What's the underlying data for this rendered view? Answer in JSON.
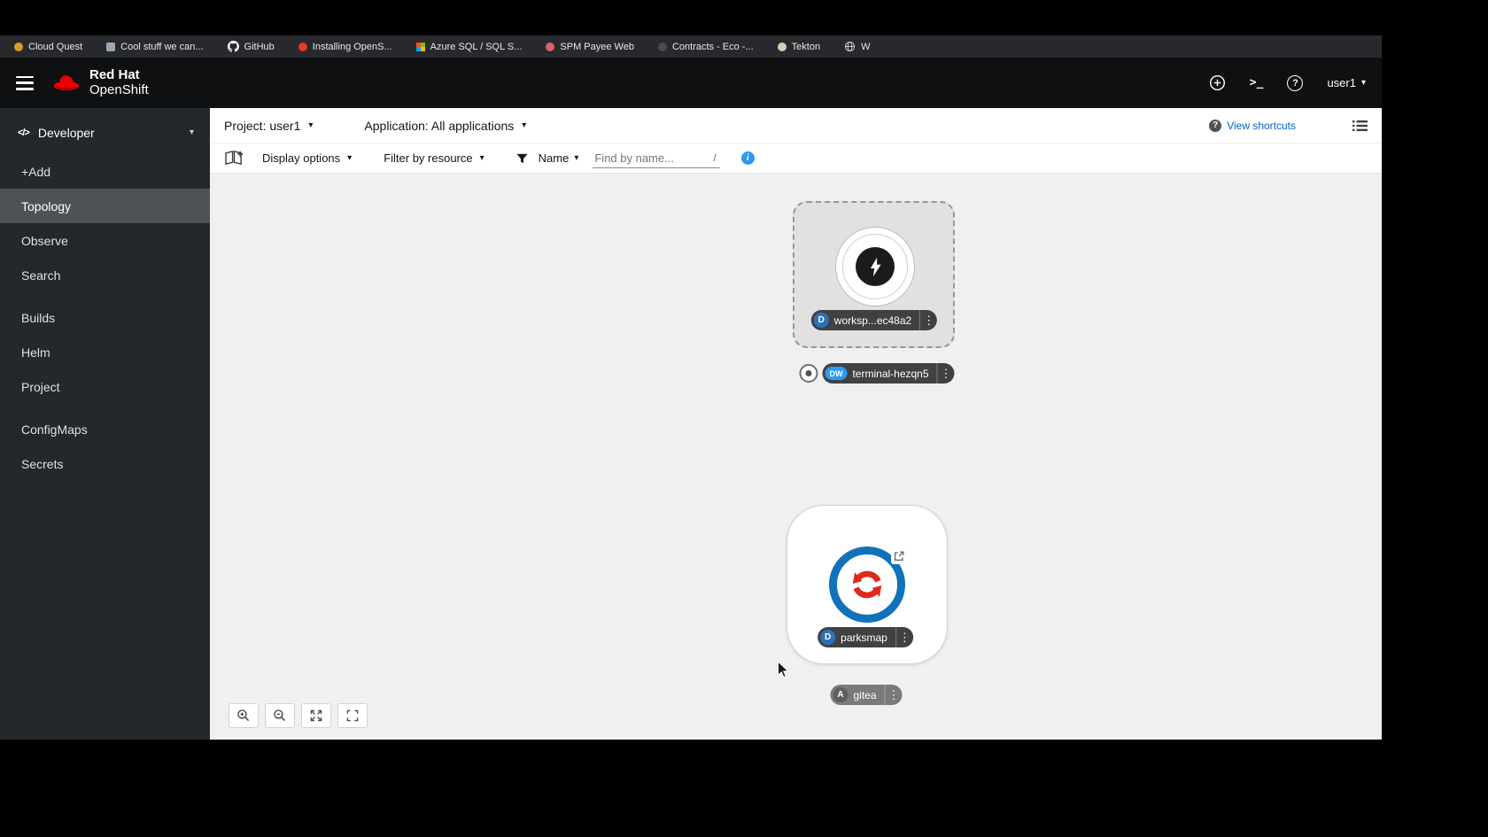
{
  "colors": {
    "masthead_bg": "#0f1012",
    "bookmarks_bg": "#28292d",
    "sidebar_bg": "#24272b",
    "sidebar_active_bg": "#4f5255",
    "canvas_bg": "#f0f0f0",
    "link_blue": "#0066cc",
    "info_blue": "#2b9af3",
    "badge_deployment": "#2d72b8",
    "badge_devworkspace": "#2b9af3",
    "redhat_red": "#ee0000",
    "parksmap_ring_blue": "#1172ba",
    "parksmap_arrows_red": "#e0281c"
  },
  "bookmarks": {
    "items": [
      {
        "label": "Cloud Quest",
        "color": "#d99c27"
      },
      {
        "label": "Cool stuff we can...",
        "color": "#9aa7b0"
      },
      {
        "label": "GitHub",
        "color": "#ffffff"
      },
      {
        "label": "Installing OpenS...",
        "color": "#e23a2e"
      },
      {
        "label": "Azure SQL / SQL S...",
        "color": "#f25022"
      },
      {
        "label": "SPM Payee Web",
        "color": "#e05c6e"
      },
      {
        "label": "Contracts - Eco -...",
        "color": "#4a4a4a"
      },
      {
        "label": "Tekton",
        "color": "#d9cbb8"
      },
      {
        "label": "W",
        "color": "#cccccc"
      }
    ]
  },
  "masthead": {
    "brand_top": "Red Hat",
    "brand_bottom": "OpenShift",
    "username": "user1"
  },
  "sidebar": {
    "perspective": "Developer",
    "items": [
      {
        "label": "+Add"
      },
      {
        "label": "Topology"
      },
      {
        "label": "Observe"
      },
      {
        "label": "Search"
      },
      {
        "label": "Builds"
      },
      {
        "label": "Helm"
      },
      {
        "label": "Project"
      },
      {
        "label": "ConfigMaps"
      },
      {
        "label": "Secrets"
      }
    ]
  },
  "context_bar": {
    "project": "Project: user1",
    "application": "Application: All applications",
    "view_shortcuts": "View shortcuts"
  },
  "toolbar": {
    "display_options": "Display options",
    "filter_by_resource": "Filter by resource",
    "name_filter": "Name",
    "find_placeholder": "Find by name...",
    "shortcut_hint": "/"
  },
  "topology": {
    "workspace": {
      "badge": "D",
      "label": "worksp...ec48a2"
    },
    "terminal": {
      "badge": "DW",
      "label": "terminal-hezqn5"
    },
    "parksmap": {
      "badge": "D",
      "label": "parksmap"
    },
    "gitea": {
      "badge": "A",
      "label": "gitea"
    }
  },
  "icons": {
    "kebab": "⋮",
    "caret_down": "▾",
    "code": "</>",
    "terminal_prompt": ">_",
    "question": "?",
    "info": "i"
  }
}
